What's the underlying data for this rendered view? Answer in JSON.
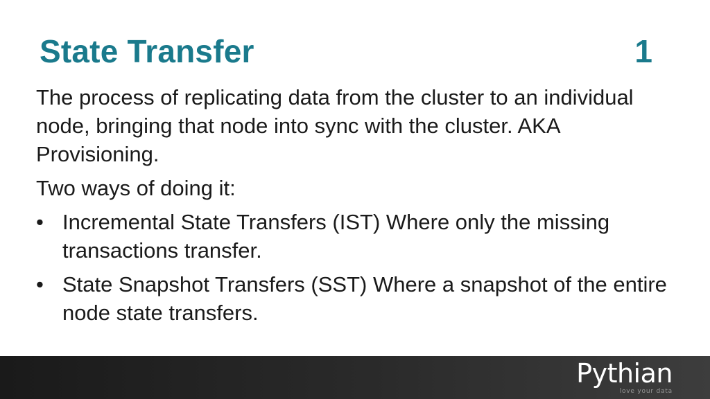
{
  "slide": {
    "title": "State Transfer",
    "number": "1",
    "paragraphs": [
      "The process of replicating data from the cluster to an individual node, bringing that node into sync with the cluster. AKA Provisioning.",
      "Two ways of doing it:"
    ],
    "bullet_symbol": "•",
    "bullets": [
      "Incremental State Transfers (IST) Where only the missing transactions transfer.",
      "State Snapshot Transfers (SST) Where a snapshot of the entire node state transfers."
    ]
  },
  "footer": {
    "logo_text": "Pythian",
    "tagline": "love your data"
  },
  "colors": {
    "title": "#1a7a8c",
    "body_text": "#1a1a1a",
    "footer_bg": "#2b2b2b"
  }
}
